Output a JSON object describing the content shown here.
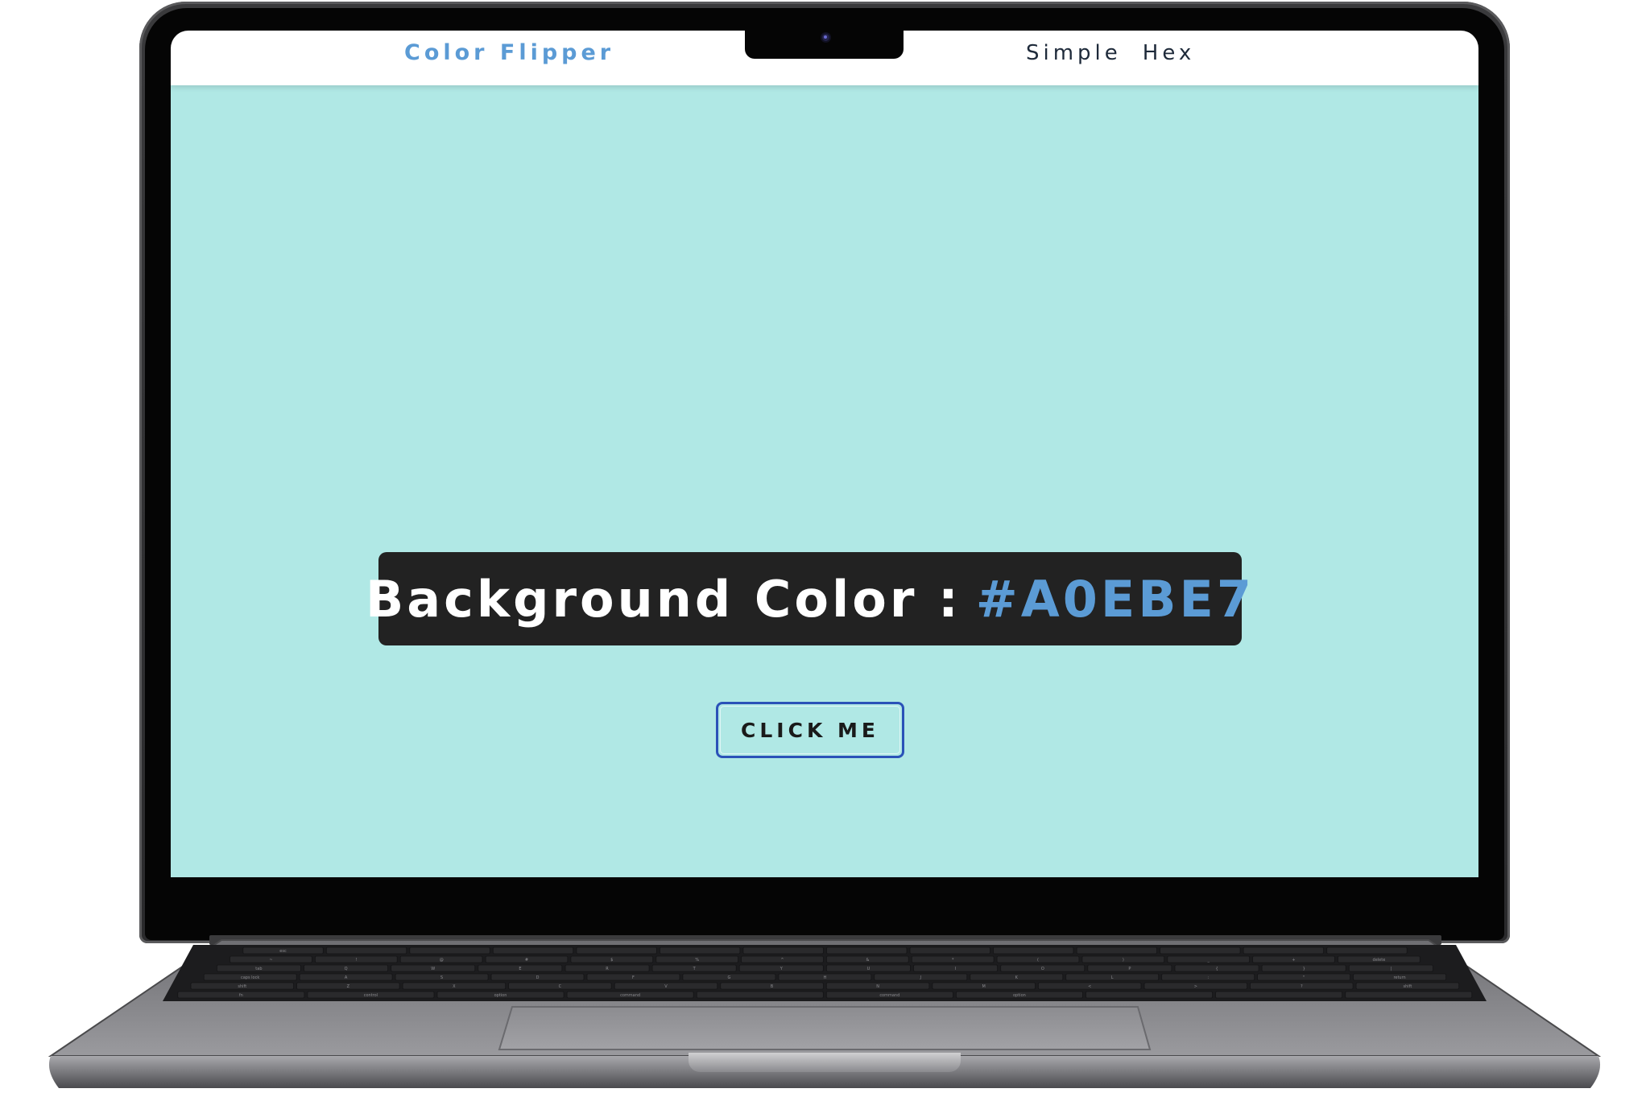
{
  "navbar": {
    "brand": "Color Flipper",
    "links": [
      "Simple",
      "Hex"
    ]
  },
  "main": {
    "color_label": "Background Color :",
    "color_value": "#A0EBE7",
    "button_label": "CLICK ME"
  },
  "colors": {
    "page_background": "#B0E8E5",
    "brand": "#5B9BD5",
    "value_text": "#5B9BD5",
    "box_background": "#222222",
    "button_border": "#2A52B8",
    "nav_text": "#1E2A3A"
  },
  "keyboard": {
    "row1": [
      "esc",
      "",
      "",
      "",
      "",
      "",
      "",
      "",
      "",
      "",
      "",
      "",
      "",
      ""
    ],
    "row2": [
      "~",
      "!",
      "@",
      "#",
      "$",
      "%",
      "^",
      "&",
      "*",
      "(",
      ")",
      "_",
      "+",
      "delete"
    ],
    "row3": [
      "tab",
      "Q",
      "W",
      "E",
      "R",
      "T",
      "Y",
      "U",
      "I",
      "O",
      "P",
      "{",
      "}",
      "|"
    ],
    "row4": [
      "caps lock",
      "A",
      "S",
      "D",
      "F",
      "G",
      "H",
      "J",
      "K",
      "L",
      ":",
      "\"",
      "return"
    ],
    "row5": [
      "shift",
      "Z",
      "X",
      "C",
      "V",
      "B",
      "N",
      "M",
      "<",
      ">",
      "?",
      "shift"
    ],
    "row6": [
      "fn",
      "control",
      "option",
      "command",
      "",
      "command",
      "option",
      "",
      "",
      ""
    ]
  }
}
